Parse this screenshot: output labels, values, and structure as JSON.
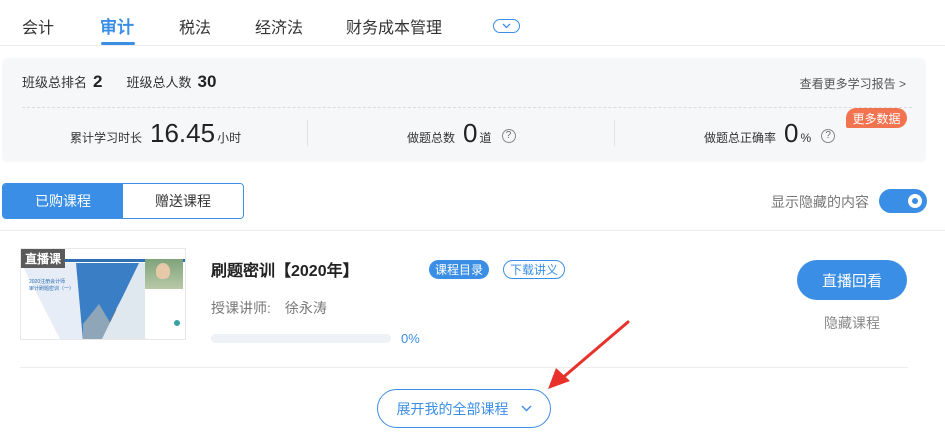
{
  "tabs": [
    {
      "label": "会计",
      "active": false
    },
    {
      "label": "审计",
      "active": true
    },
    {
      "label": "税法",
      "active": false
    },
    {
      "label": "经济法",
      "active": false
    },
    {
      "label": "财务成本管理",
      "active": false
    }
  ],
  "stats": {
    "rank_label": "班级总排名",
    "rank_value": "2",
    "total_label": "班级总人数",
    "total_value": "30",
    "report_link": "查看更多学习报告 >",
    "study_time_label": "累计学习时长",
    "study_time_value": "16.45",
    "study_time_unit": "小时",
    "questions_label": "做题总数",
    "questions_value": "0",
    "questions_unit": "道",
    "accuracy_label": "做题总正确率",
    "accuracy_value": "0",
    "accuracy_unit": "%",
    "more_data_badge": "更多数据"
  },
  "course_tabs": [
    {
      "label": "已购课程",
      "active": true
    },
    {
      "label": "赠送课程",
      "active": false
    }
  ],
  "show_hidden": {
    "label": "显示隐藏的内容",
    "on": true
  },
  "course": {
    "live_tag": "直播课",
    "thumb_text": "2020注册会计师\n审计刷题密训（一）",
    "title": "刷题密训【2020年】",
    "catalog_button": "课程目录",
    "download_button": "下载讲义",
    "teacher_label": "授课讲师:",
    "teacher_name": "徐永涛",
    "progress_fraction": 0,
    "progress_label": "0%",
    "replay_button": "直播回看",
    "hide_button": "隐藏课程"
  },
  "expand_button": "展开我的全部课程",
  "colors": {
    "accent": "#3a8ee6",
    "badge": "#f17350",
    "annotation": "#e8312a"
  }
}
